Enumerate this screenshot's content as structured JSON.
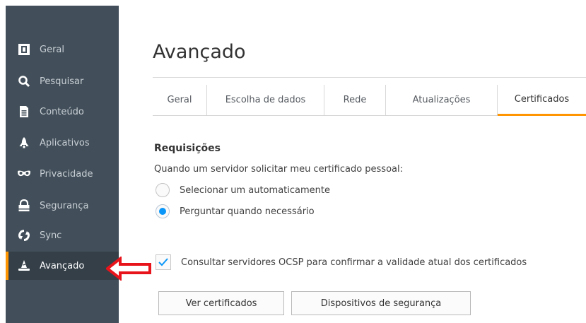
{
  "sidebar": {
    "items": [
      {
        "label": "Geral",
        "icon": "geral-icon"
      },
      {
        "label": "Pesquisar",
        "icon": "search-icon"
      },
      {
        "label": "Conteúdo",
        "icon": "document-icon"
      },
      {
        "label": "Aplicativos",
        "icon": "rocket-icon"
      },
      {
        "label": "Privacidade",
        "icon": "mask-icon"
      },
      {
        "label": "Segurança",
        "icon": "lock-icon"
      },
      {
        "label": "Sync",
        "icon": "sync-icon"
      },
      {
        "label": "Avançado",
        "icon": "wizard-hat-icon",
        "selected": true
      }
    ]
  },
  "main": {
    "title": "Avançado",
    "tabs": [
      "Geral",
      "Escolha de dados",
      "Rede",
      "Atualizações",
      "Certificados"
    ],
    "active_tab": "Certificados",
    "section_title": "Requisições",
    "description": "Quando um servidor solicitar meu certificado pessoal:",
    "options": [
      {
        "label": "Selecionar um automaticamente",
        "selected": false
      },
      {
        "label": "Perguntar quando necessário",
        "selected": true
      }
    ],
    "ocsp": {
      "label": "Consultar servidores OCSP para confirmar a validade atual dos certificados",
      "checked": true
    },
    "buttons": {
      "view_certs": "Ver certificados",
      "security_devices": "Dispositivos de segurança"
    }
  },
  "colors": {
    "sidebar_bg": "#424f5a",
    "accent": "#ff9500",
    "radio_blue": "#0996f8",
    "arrow_red": "#e8141b"
  }
}
